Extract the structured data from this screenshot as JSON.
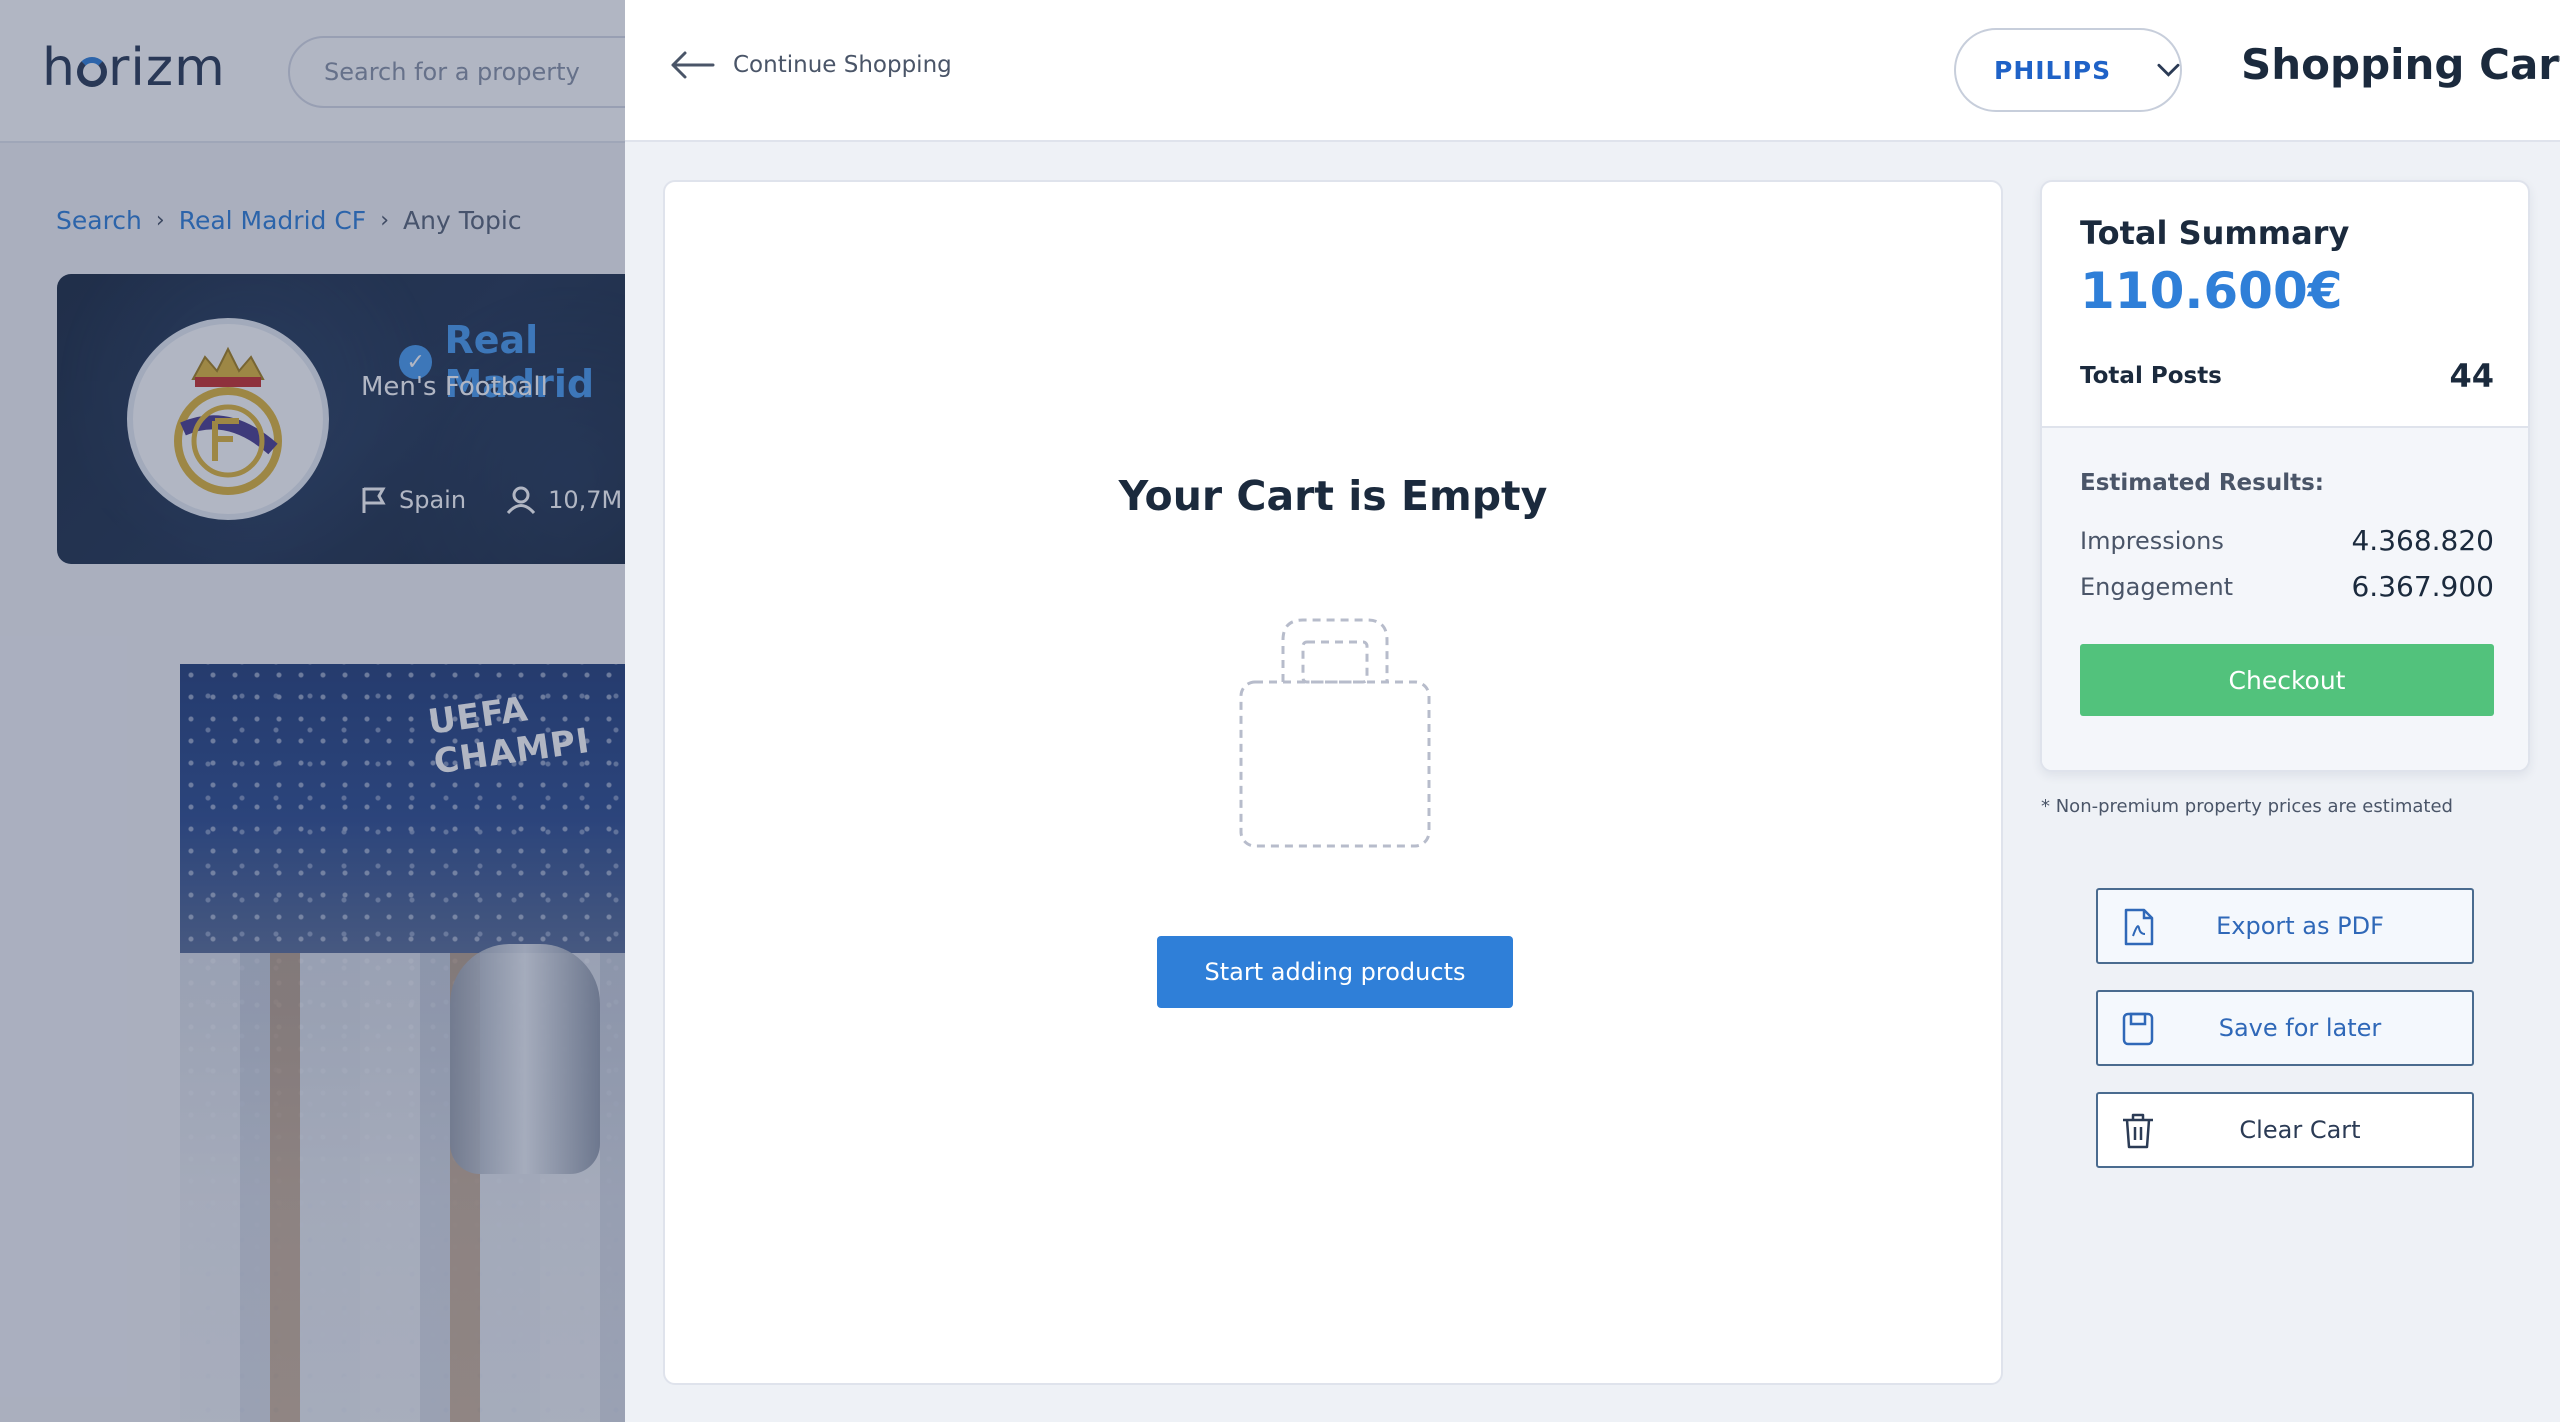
{
  "background": {
    "logo": "horizm",
    "search_placeholder": "Search for a property",
    "breadcrumb": {
      "items": [
        "Search",
        "Real Madrid CF"
      ],
      "current": "Any Topic"
    },
    "club": {
      "name": "Real Madrid",
      "subtitle": "Men's Football",
      "country": "Spain",
      "followers": "10,7M"
    },
    "photo_banner": "UEFA CHAMPI"
  },
  "header": {
    "continue_label": "Continue Shopping",
    "brand": "PHILIPS",
    "title": "Shopping Cart"
  },
  "cart": {
    "empty_title": "Your Cart is Empty",
    "start_button": "Start adding products"
  },
  "summary": {
    "title": "Total Summary",
    "amount": "110.600€",
    "posts_label": "Total Posts",
    "posts_value": "44",
    "estimated_title": "Estimated Results:",
    "impressions_label": "Impressions",
    "impressions_value": "4.368.820",
    "engagement_label": "Engagement",
    "engagement_value": "6.367.900",
    "checkout_label": "Checkout",
    "note": "* Non-premium property prices are estimated"
  },
  "actions": {
    "export_pdf": "Export as PDF",
    "save_later": "Save for later",
    "clear_cart": "Clear Cart"
  },
  "colors": {
    "accent": "#2f7fd8",
    "checkout_green": "#52c27c",
    "text_dark": "#1b2a3d"
  }
}
